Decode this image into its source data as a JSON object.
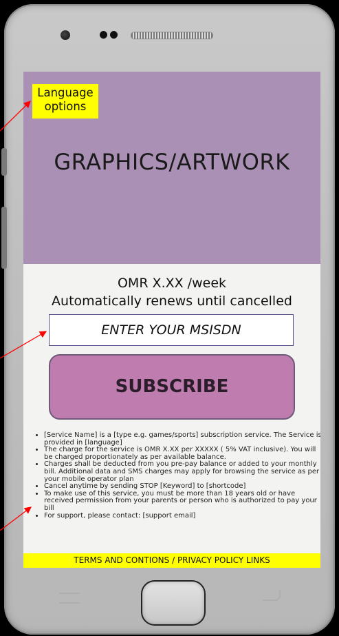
{
  "banner": {
    "language_label": "Language\noptions",
    "artwork_text": "GRAPHICS/ARTWORK"
  },
  "pricing": {
    "price_text": "OMR X.XX /week",
    "renew_text": "Automatically renews until cancelled"
  },
  "msisdn": {
    "placeholder": "ENTER YOUR MSISDN"
  },
  "subscribe": {
    "label": "SUBSCRIBE"
  },
  "terms": [
    "[Service Name] is a [type e.g. games/sports] subscription service. The Service is provided in [language]",
    "The charge for the service is OMR X.XX per XXXXX ( 5% VAT inclusive). You will be charged proportionately as per available balance.",
    "Charges shall be deducted from you pre-pay balance or added to your monthly bill. Additional data and SMS charges may apply for browsing the service  as per your mobile operator plan",
    "Cancel anytime by sending STOP [Keyword] to [shortcode]",
    "To make use of this service, you must be more than 18 years old or have received permission from your parents or person who is authorized to pay your bill",
    "For support, please contact: [support email]"
  ],
  "footer": {
    "links_text": "TERMS AND CONTIONS / PRIVACY POLICY LINKS"
  },
  "colors": {
    "banner": "#ab90b5",
    "highlight": "#ffff00",
    "subscribe_button": "#bf7caf",
    "arrow": "#ff0000"
  }
}
